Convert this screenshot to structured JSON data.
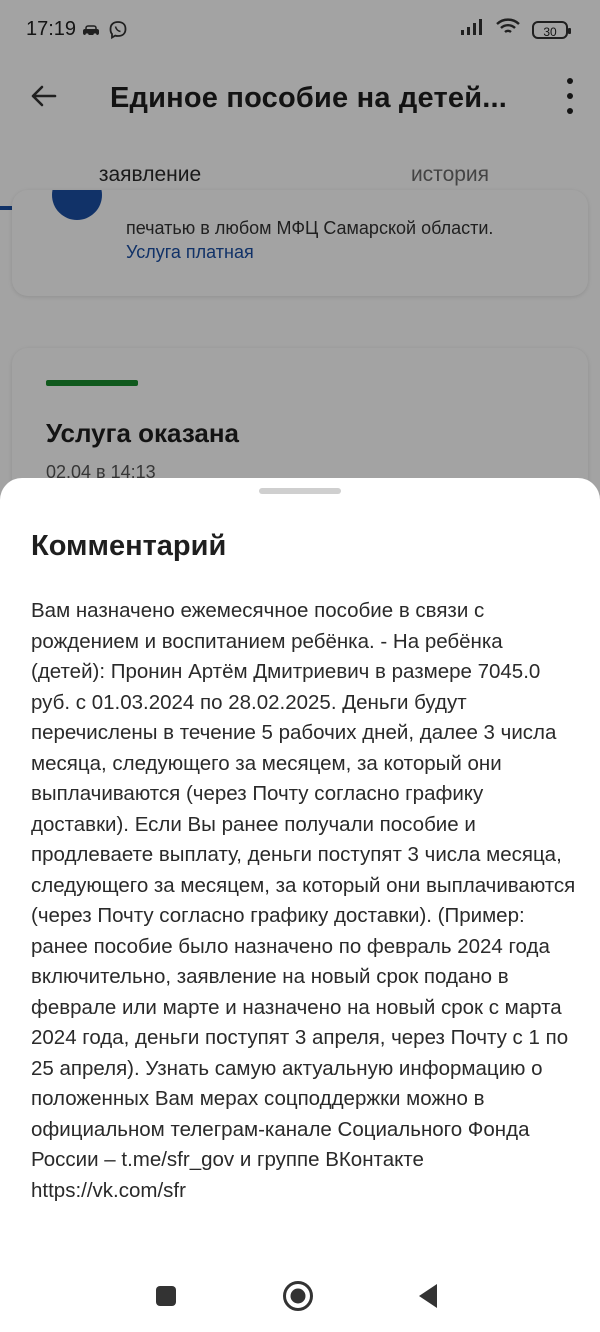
{
  "status_bar": {
    "time": "17:19",
    "battery": "30",
    "icons": [
      "car-icon",
      "viber-icon",
      "signal-icon",
      "wifi-icon",
      "battery-icon"
    ]
  },
  "app_bar": {
    "title": "Единое пособие на детей...",
    "icons": [
      "back-arrow-icon",
      "more-vertical-icon"
    ]
  },
  "tabs": [
    {
      "label": "заявление",
      "active": true
    },
    {
      "label": "история",
      "active": false
    }
  ],
  "background": {
    "info_card": {
      "text": "печатью в любом МФЦ Самарской области.",
      "link": "Услуга платная"
    },
    "status_card": {
      "title": "Услуга оказана",
      "date": "02.04 в 14:13"
    }
  },
  "comment_sheet": {
    "title": "Комментарий",
    "text": "Вам назначено ежемесячное пособие в связи с рождением и воспитанием ребёнка. - На ребёнка (детей): Пронин Артём Дмитриевич в размере 7045.0 руб. с 01.03.2024 по 28.02.2025. Деньги будут перечислены в течение 5 рабочих дней, далее 3 числа месяца, следующего за месяцем, за который они выплачиваются (через Почту согласно графику доставки). Если Вы ранее получали пособие и продлеваете выплату, деньги поступят 3 числа месяца, следующего за месяцем, за который они выплачиваются (через Почту согласно графику доставки). (Пример: ранее пособие было назначено по февраль 2024 года включительно, заявление на новый срок подано в феврале или марте и назначено на новый срок с марта 2024 года, деньги поступят 3 апреля, через Почту с 1 по 25 апреля). Узнать самую актуальную информацию о положенных Вам мерах соцподдержки можно в официальном телеграм-канале Социального Фонда России – t.me/sfr_gov и группе ВКонтакте https://vk.com/sfr"
  },
  "nav_bar": {
    "buttons": [
      "recents-square-icon",
      "home-circle-icon",
      "back-triangle-icon"
    ]
  },
  "colors": {
    "accent": "#1b4fa3",
    "success": "#1a8b2e",
    "scrim": "#5c5c5c"
  }
}
